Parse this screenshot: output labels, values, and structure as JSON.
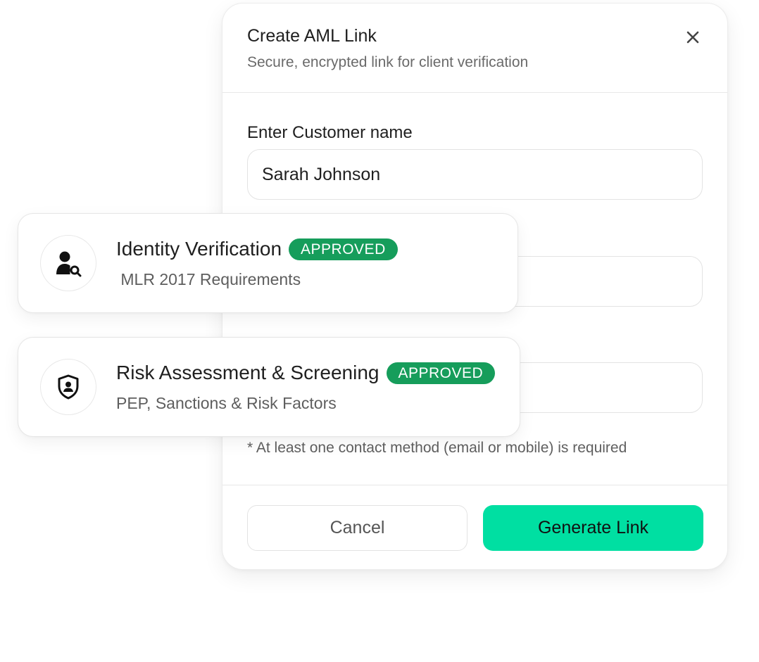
{
  "modal": {
    "title": "Create AML Link",
    "subtitle": "Secure, encrypted link for client verification",
    "close_icon": "close-icon",
    "name_label": "Enter Customer name",
    "name_value": "Sarah Johnson",
    "note": "* At least one contact method (email or mobile) is required",
    "cancel_label": "Cancel",
    "generate_label": "Generate Link"
  },
  "cards": {
    "identity": {
      "title": "Identity Verification",
      "badge": "APPROVED",
      "subtitle": " MLR 2017 Requirements",
      "icon": "user-search-icon"
    },
    "risk": {
      "title": "Risk Assessment & Screening",
      "badge": "APPROVED",
      "subtitle": "PEP, Sanctions & Risk Factors",
      "icon": "shield-user-icon"
    }
  },
  "colors": {
    "accent": "#00dfa2",
    "badge": "#169d5b"
  }
}
